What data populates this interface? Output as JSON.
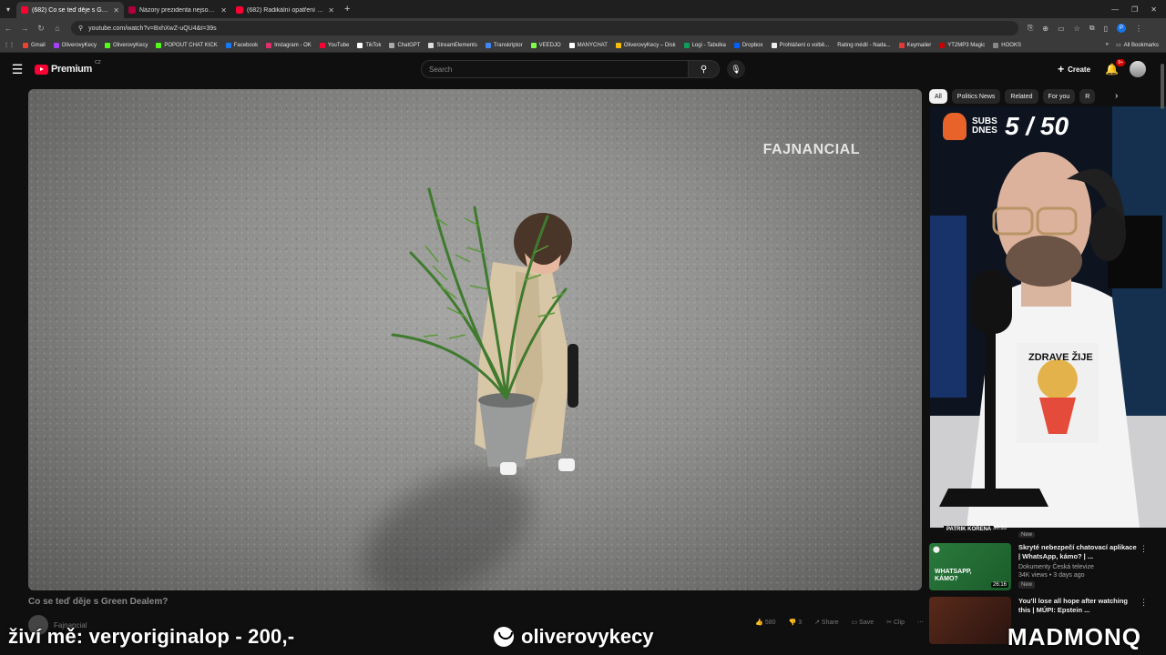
{
  "browser": {
    "tabs": [
      {
        "title": "(682) Co se teď děje s Green De...",
        "active": true
      },
      {
        "title": "Názory prezidenta nejsou rele...",
        "active": false
      },
      {
        "title": "(682) Radikální opatření vlády...",
        "active": false
      }
    ],
    "url": "youtube.com/watch?v=BxhXwZ-uQU4&t=39s",
    "profile_initial": "P",
    "bookmarks": [
      "Gmail",
      "OliverovyKecy",
      "OliverovyKecy",
      "POPOUT CHAT KICK",
      "Facebook",
      "Instagram - OK",
      "YouTube",
      "TikTok",
      "ChatGPT",
      "StreamElements",
      "Transkriptor",
      "VEEDJO",
      "MANYCHAT",
      "OliverovyKecy – Disk",
      "Logi - Tabulka",
      "Dropbox",
      "Prohlášení o volbě...",
      "Rating médií - Nada...",
      "Keymailer",
      "YT2MP3 Magic",
      "HOOKS"
    ],
    "all_bookmarks": "All Bookmarks"
  },
  "youtube": {
    "brand": "Premium",
    "country": "CZ",
    "search_placeholder": "Search",
    "create_label": "Create",
    "notif_count": "9+"
  },
  "video": {
    "watermark": "FAJNANCIAL",
    "title": "Co se teď děje s Green Dealem?",
    "channel": "Fajnancial",
    "likes": "580",
    "dislikes": "3",
    "share": "Share",
    "save": "Save",
    "clip": "Clip"
  },
  "chips": [
    "All",
    "Politics News",
    "Related",
    "For you",
    "R"
  ],
  "webcam": {
    "subs_label": "SUBS DNES",
    "subs_count": "5 / 50",
    "shirt_text": "ZDRAVE ŽIJE"
  },
  "recommendations": {
    "partial": {
      "channel_label": "PATRIK KOŘENÁ",
      "duration": "30:35",
      "badge": "New"
    },
    "items": [
      {
        "title": "Skryté nebezpečí chatovací aplikace | WhatsApp, kámo? | ...",
        "channel": "Dokumenty Česká televize",
        "stats": "34K views • 3 days ago",
        "duration": "26:16",
        "badge": "New",
        "thumb_text": "WHATSAPP, KÁMO?"
      },
      {
        "title": "You'll lose all hope after watching this | MÚPI: Epstein ...",
        "channel": "",
        "stats": "",
        "duration": "",
        "badge": "",
        "thumb_text": ""
      }
    ]
  },
  "overlay": {
    "left": "živí mě: veryoriginalop - 200,-",
    "mid": "oliverovykecy",
    "right": "MADMONQ"
  }
}
